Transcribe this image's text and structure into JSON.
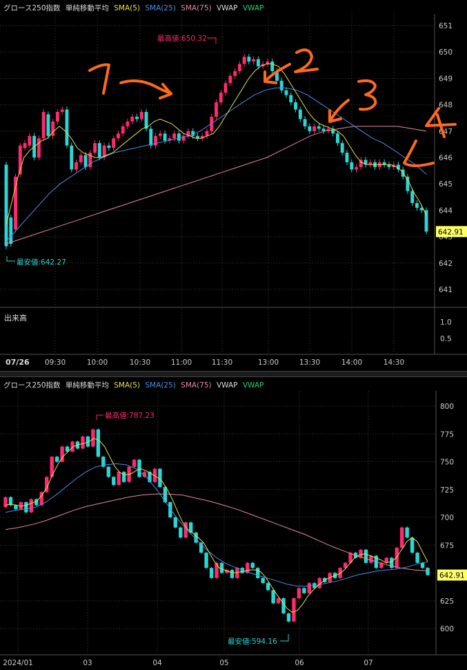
{
  "chart_data": [
    {
      "type": "candlestick",
      "legend": {
        "index": "グロース250指数",
        "group": "単純移動平均",
        "sma5": "SMA(5)",
        "sma25": "SMA(25)",
        "sma75": "SMA(75)",
        "vwap": "VWAP",
        "vwap2": "VWAP"
      },
      "colors": {
        "up": "#ff2a6d",
        "down": "#2ad6d6",
        "sma5": "#e6e04a",
        "sma25": "#4a8fe6",
        "sma75": "#e68aa6",
        "price_tag_bg": "#ffff66"
      },
      "date_label": "07/26",
      "x_ticks": [
        "09:30",
        "10:00",
        "10:30",
        "11:00",
        "11:30",
        "13:00",
        "13:30",
        "14:00",
        "14:30"
      ],
      "y_ticks": [
        "651",
        "650",
        "649",
        "648",
        "647",
        "646",
        "645",
        "644",
        "643",
        "642",
        "641"
      ],
      "ylim": [
        640.5,
        651.5
      ],
      "last_price": "642.91",
      "high_label": "最高値:650.32",
      "low_label": "最安値:642.27",
      "volume_panel": {
        "label": "出来高",
        "y_ticks": [
          "1.0",
          "0.5"
        ]
      },
      "annotations": [
        "1",
        "2",
        "3",
        "4"
      ],
      "candles": [
        [
          645.7,
          642.3
        ],
        [
          643.5,
          642.4
        ],
        [
          643.0,
          645.2
        ],
        [
          645.3,
          646.5
        ],
        [
          646.4,
          646.6
        ],
        [
          646.5,
          646.9
        ],
        [
          646.9,
          646.0
        ],
        [
          646.0,
          646.8
        ],
        [
          646.8,
          647.9
        ],
        [
          647.8,
          646.9
        ],
        [
          646.9,
          647.5
        ],
        [
          647.5,
          647.9
        ],
        [
          647.9,
          648.0
        ],
        [
          648.0,
          646.5
        ],
        [
          646.5,
          645.5
        ],
        [
          645.5,
          645.8
        ],
        [
          645.8,
          646.1
        ],
        [
          646.1,
          645.6
        ],
        [
          645.6,
          646.2
        ],
        [
          646.2,
          646.6
        ],
        [
          646.6,
          646.0
        ],
        [
          646.0,
          646.5
        ],
        [
          646.5,
          646.4
        ],
        [
          646.4,
          646.8
        ],
        [
          646.8,
          647.0
        ],
        [
          647.0,
          647.3
        ],
        [
          647.3,
          647.5
        ],
        [
          647.5,
          647.7
        ],
        [
          647.7,
          647.6
        ],
        [
          647.6,
          647.9
        ],
        [
          647.9,
          647.2
        ],
        [
          647.2,
          646.5
        ],
        [
          646.5,
          646.9
        ],
        [
          646.9,
          647.0
        ],
        [
          647.0,
          646.7
        ],
        [
          646.7,
          646.8
        ],
        [
          646.8,
          647.0
        ],
        [
          647.0,
          646.7
        ],
        [
          646.7,
          646.9
        ],
        [
          646.9,
          647.1
        ],
        [
          647.1,
          646.9
        ],
        [
          646.9,
          646.8
        ],
        [
          646.8,
          646.9
        ],
        [
          646.9,
          647.1
        ],
        [
          647.1,
          647.7
        ],
        [
          647.7,
          648.3
        ],
        [
          648.3,
          648.7
        ],
        [
          648.7,
          649.1
        ],
        [
          649.1,
          649.4
        ],
        [
          649.4,
          649.6
        ],
        [
          649.6,
          649.9
        ],
        [
          649.9,
          650.2
        ],
        [
          650.2,
          650.0
        ],
        [
          650.0,
          650.1
        ],
        [
          650.1,
          649.8
        ],
        [
          649.8,
          649.9
        ],
        [
          649.9,
          650.0
        ],
        [
          650.0,
          649.6
        ],
        [
          649.6,
          649.2
        ],
        [
          649.2,
          648.8
        ],
        [
          648.8,
          648.6
        ],
        [
          648.6,
          648.3
        ],
        [
          648.3,
          648.0
        ],
        [
          648.0,
          647.6
        ],
        [
          647.6,
          647.3
        ],
        [
          647.3,
          647.1
        ],
        [
          647.1,
          647.3
        ],
        [
          647.3,
          647.2
        ],
        [
          647.2,
          647.1
        ],
        [
          647.1,
          647.2
        ],
        [
          647.2,
          647.0
        ],
        [
          647.0,
          646.6
        ],
        [
          646.6,
          646.2
        ],
        [
          646.2,
          645.8
        ],
        [
          645.8,
          645.5
        ],
        [
          645.5,
          645.6
        ],
        [
          645.6,
          645.9
        ],
        [
          645.9,
          645.7
        ],
        [
          645.7,
          645.8
        ],
        [
          645.8,
          645.6
        ],
        [
          645.6,
          645.8
        ],
        [
          645.8,
          645.7
        ],
        [
          645.7,
          645.6
        ],
        [
          645.6,
          645.7
        ],
        [
          645.7,
          645.5
        ],
        [
          645.5,
          645.2
        ],
        [
          645.2,
          644.6
        ],
        [
          644.6,
          644.1
        ],
        [
          644.1,
          643.9
        ],
        [
          643.9,
          643.8
        ],
        [
          643.8,
          642.91
        ]
      ],
      "sma5": [
        643.2,
        644.2,
        645.2,
        646.0,
        646.3,
        646.5,
        646.7,
        646.8,
        647.1,
        647.3,
        647.1,
        646.8,
        646.4,
        646.2,
        646.1,
        646.0,
        646.0,
        646.1,
        646.2,
        646.4,
        646.6,
        646.8,
        647.0,
        647.2,
        647.3,
        647.5,
        647.6,
        647.5,
        647.4,
        647.2,
        647.0,
        646.9,
        646.8,
        646.8,
        646.9,
        647.0,
        647.3,
        647.7,
        648.1,
        648.5,
        648.9,
        649.3,
        649.6,
        649.8,
        649.9,
        649.9,
        649.8,
        649.5,
        649.1,
        648.7,
        648.3,
        647.9,
        647.6,
        647.4,
        647.3,
        647.2,
        647.1,
        646.9,
        646.5,
        646.1,
        645.8,
        645.7,
        645.7,
        645.7,
        645.7,
        645.7,
        645.6,
        645.4,
        645.0,
        644.5,
        644.1,
        643.6
      ],
      "sma25": [
        642.5,
        643.0,
        643.5,
        644.0,
        644.5,
        644.9,
        645.2,
        645.5,
        645.8,
        646.0,
        646.2,
        646.3,
        646.4,
        646.5,
        646.6,
        646.7,
        646.8,
        646.9,
        647.1,
        647.4,
        647.7,
        648.0,
        648.3,
        648.6,
        648.8,
        648.9,
        648.9,
        648.8,
        648.6,
        648.3,
        648.0,
        647.7,
        647.4,
        647.1,
        646.8,
        646.6,
        646.3,
        646.0,
        645.7,
        645.3
      ],
      "sma75": [
        642.4,
        642.6,
        642.8,
        643.0,
        643.2,
        643.4,
        643.6,
        643.8,
        644.0,
        644.2,
        644.4,
        644.6,
        644.8,
        645.0,
        645.2,
        645.4,
        645.6,
        645.8,
        646.0,
        646.3,
        646.6,
        646.9,
        647.1,
        647.2,
        647.3,
        647.3,
        647.3,
        647.3,
        647.2,
        647.1
      ]
    },
    {
      "type": "candlestick",
      "legend": {
        "index": "グロース250指数",
        "group": "単純移動平均",
        "sma5": "SMA(5)",
        "sma25": "SMA(25)",
        "sma75": "SMA(75)",
        "vwap": "VWAP",
        "vwap2": "VWAP"
      },
      "x_ticks": [
        "2024/01",
        "03",
        "04",
        "05",
        "06",
        "07"
      ],
      "y_ticks": [
        "800",
        "775",
        "750",
        "725",
        "700",
        "675",
        "650",
        "625",
        "600"
      ],
      "ylim": [
        590,
        810
      ],
      "last_price": "642.91",
      "high_label": "最高値:787.23",
      "low_label": "最安値:594.16",
      "candles": [
        [
          710,
          720
        ],
        [
          720,
          712
        ],
        [
          712,
          708
        ],
        [
          708,
          715
        ],
        [
          715,
          705
        ],
        [
          705,
          718
        ],
        [
          718,
          712
        ],
        [
          712,
          725
        ],
        [
          725,
          740
        ],
        [
          740,
          760
        ],
        [
          760,
          755
        ],
        [
          755,
          770
        ],
        [
          770,
          765
        ],
        [
          765,
          775
        ],
        [
          775,
          768
        ],
        [
          768,
          780
        ],
        [
          780,
          770
        ],
        [
          770,
          787
        ],
        [
          787,
          760
        ],
        [
          760,
          750
        ],
        [
          750,
          740
        ],
        [
          740,
          732
        ],
        [
          732,
          745
        ],
        [
          745,
          735
        ],
        [
          735,
          750
        ],
        [
          750,
          757
        ],
        [
          757,
          740
        ],
        [
          740,
          745
        ],
        [
          745,
          735
        ],
        [
          735,
          748
        ],
        [
          748,
          730
        ],
        [
          730,
          715
        ],
        [
          715,
          700
        ],
        [
          700,
          690
        ],
        [
          690,
          680
        ],
        [
          680,
          695
        ],
        [
          695,
          685
        ],
        [
          685,
          675
        ],
        [
          675,
          665
        ],
        [
          665,
          650
        ],
        [
          650,
          640
        ],
        [
          640,
          655
        ],
        [
          655,
          645
        ],
        [
          645,
          648
        ],
        [
          648,
          640
        ],
        [
          640,
          650
        ],
        [
          650,
          645
        ],
        [
          645,
          655
        ],
        [
          655,
          650
        ],
        [
          650,
          640
        ],
        [
          640,
          635
        ],
        [
          635,
          628
        ],
        [
          628,
          615
        ],
        [
          615,
          620
        ],
        [
          620,
          605
        ],
        [
          605,
          597
        ],
        [
          597,
          620
        ],
        [
          620,
          630
        ],
        [
          630,
          625
        ],
        [
          625,
          635
        ],
        [
          635,
          630
        ],
        [
          630,
          640
        ],
        [
          640,
          636
        ],
        [
          636,
          645
        ],
        [
          645,
          640
        ],
        [
          640,
          650
        ],
        [
          650,
          655
        ],
        [
          655,
          665
        ],
        [
          665,
          660
        ],
        [
          660,
          668
        ],
        [
          668,
          655
        ],
        [
          655,
          662
        ],
        [
          662,
          650
        ],
        [
          650,
          655
        ],
        [
          655,
          660
        ],
        [
          660,
          650
        ],
        [
          650,
          670
        ],
        [
          670,
          690
        ],
        [
          690,
          680
        ],
        [
          680,
          665
        ],
        [
          665,
          655
        ],
        [
          655,
          650
        ],
        [
          650,
          642.91
        ]
      ],
      "sma5": [
        712,
        713,
        712,
        711,
        712,
        714,
        716,
        722,
        730,
        742,
        752,
        760,
        765,
        770,
        772,
        773,
        775,
        778,
        776,
        770,
        760,
        750,
        744,
        742,
        743,
        746,
        748,
        746,
        743,
        740,
        736,
        728,
        718,
        706,
        695,
        688,
        684,
        680,
        675,
        666,
        657,
        650,
        648,
        646,
        645,
        646,
        647,
        648,
        648,
        646,
        640,
        632,
        624,
        617,
        610,
        606,
        608,
        614,
        622,
        628,
        633,
        637,
        640,
        642,
        644,
        648,
        654,
        660,
        663,
        664,
        662,
        660,
        658,
        655,
        656,
        660,
        668,
        676,
        680,
        676,
        666,
        656
      ],
      "sma25": [
        705,
        707,
        708,
        710,
        715,
        722,
        730,
        738,
        745,
        750,
        752,
        753,
        752,
        748,
        740,
        728,
        714,
        700,
        688,
        678,
        668,
        660,
        654,
        650,
        646,
        643,
        640,
        637,
        634,
        632,
        632,
        633,
        635,
        637,
        640,
        643,
        645,
        647,
        648,
        649,
        651,
        654,
        656
      ],
      "sma75": [
        688,
        690,
        693,
        697,
        702,
        707,
        711,
        714,
        717,
        720,
        722,
        723,
        723,
        722,
        719,
        716,
        712,
        708,
        703,
        698,
        693,
        688,
        683,
        677,
        671,
        666,
        661,
        657,
        653,
        650,
        648,
        647
      ]
    }
  ]
}
